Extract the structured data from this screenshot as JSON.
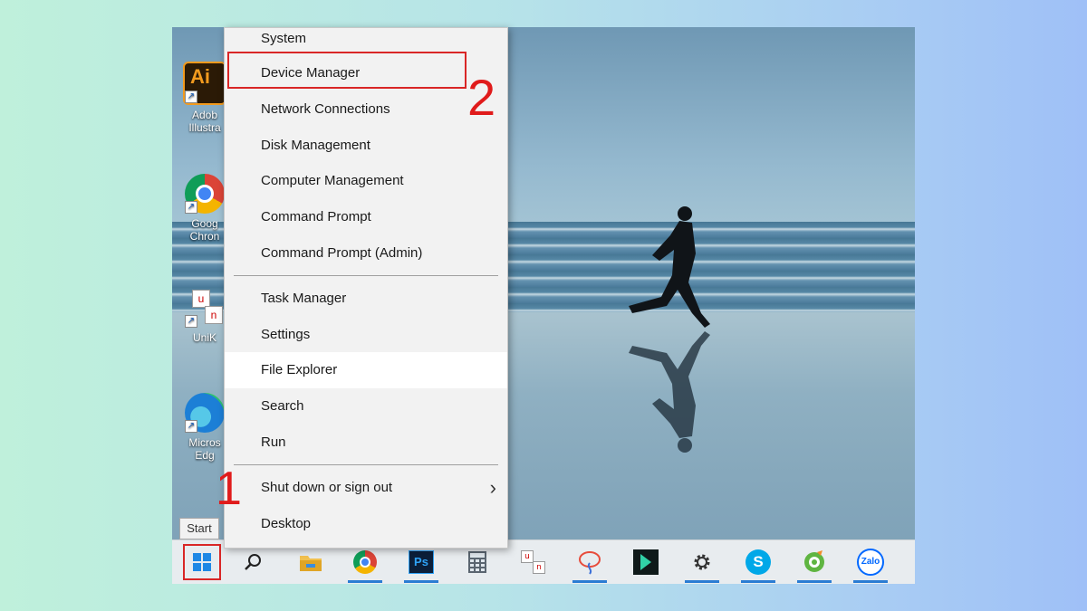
{
  "desktop": {
    "icons": [
      {
        "label": "Adob\nIllustra",
        "icon": "illustrator-icon"
      },
      {
        "label": "Goog\nChron",
        "icon": "chrome-icon"
      },
      {
        "label": "UniK",
        "icon": "unikey-icon"
      },
      {
        "label": "Micros\nEdg",
        "icon": "edge-icon"
      }
    ]
  },
  "menu": {
    "items": [
      {
        "label": "System"
      },
      {
        "label": "Device Manager"
      },
      {
        "label": "Network Connections"
      },
      {
        "label": "Disk Management"
      },
      {
        "label": "Computer Management"
      },
      {
        "label": "Command Prompt"
      },
      {
        "label": "Command Prompt (Admin)"
      },
      {
        "label": "Task Manager"
      },
      {
        "label": "Settings"
      },
      {
        "label": "File Explorer"
      },
      {
        "label": "Search"
      },
      {
        "label": "Run"
      },
      {
        "label": "Shut down or sign out"
      },
      {
        "label": "Desktop"
      }
    ]
  },
  "tooltip": {
    "start": "Start"
  },
  "annotations": {
    "step1": "1",
    "step2": "2",
    "color": "#d92626"
  },
  "taskbar": {
    "apps": [
      "start-icon",
      "search-icon",
      "file-explorer-icon",
      "chrome-icon",
      "photoshop-icon",
      "calculator-icon",
      "unikey-icon",
      "paint-icon",
      "filmora-icon",
      "settings-icon",
      "skype-icon",
      "coccoc-icon",
      "zalo-icon"
    ],
    "zalo_label": "Zalo",
    "photoshop_label": "Ps"
  }
}
